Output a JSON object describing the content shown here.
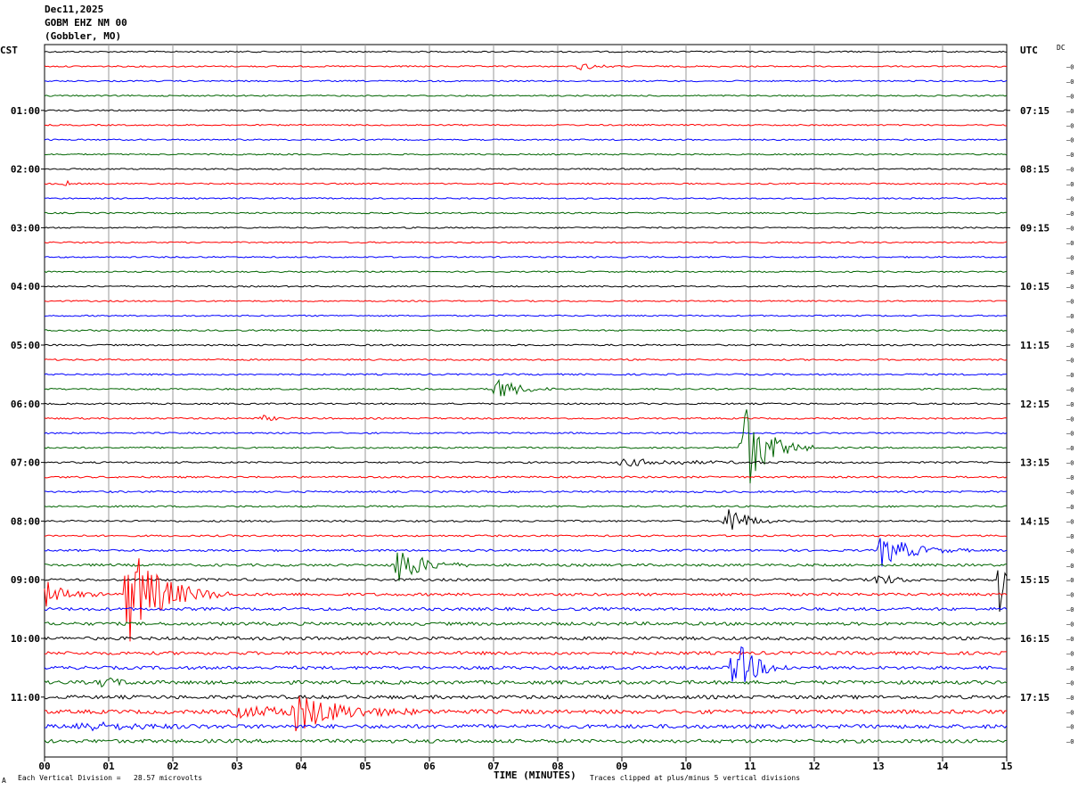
{
  "header": {
    "date": "Dec11,2025",
    "station": "GOBM EHZ NM 00",
    "location": "(Gobbler, MO)"
  },
  "labels": {
    "left_zone": "CST",
    "right_zone": "UTC",
    "dc": "DC",
    "row_marker": "—0",
    "xlabel": "TIME (MINUTES)",
    "scale_note": "Each Vertical Division =   28.57 microvolts",
    "clip_note": "Traces clipped at plus/minus 5 vertical divisions",
    "corner_mark": "A"
  },
  "chart_data": {
    "type": "line",
    "title": "",
    "xlabel": "TIME (MINUTES)",
    "ylabel": "",
    "xlim": [
      0,
      15
    ],
    "x_ticks": [
      "00",
      "01",
      "02",
      "03",
      "04",
      "05",
      "06",
      "07",
      "08",
      "09",
      "10",
      "11",
      "12",
      "13",
      "14",
      "15"
    ],
    "rows": 48,
    "minutes_per_row": 15,
    "row_colors": [
      "#000000",
      "#ff0000",
      "#0000ff",
      "#006400"
    ],
    "left_ticks": [
      {
        "row": 4,
        "label": "01:00"
      },
      {
        "row": 8,
        "label": "02:00"
      },
      {
        "row": 12,
        "label": "03:00"
      },
      {
        "row": 16,
        "label": "04:00"
      },
      {
        "row": 20,
        "label": "05:00"
      },
      {
        "row": 24,
        "label": "06:00"
      },
      {
        "row": 28,
        "label": "07:00"
      },
      {
        "row": 32,
        "label": "08:00"
      },
      {
        "row": 36,
        "label": "09:00"
      },
      {
        "row": 40,
        "label": "10:00"
      },
      {
        "row": 44,
        "label": "11:00"
      }
    ],
    "right_ticks": [
      {
        "row": 4,
        "label": "07:15"
      },
      {
        "row": 8,
        "label": "08:15"
      },
      {
        "row": 12,
        "label": "09:15"
      },
      {
        "row": 16,
        "label": "10:15"
      },
      {
        "row": 20,
        "label": "11:15"
      },
      {
        "row": 24,
        "label": "12:15"
      },
      {
        "row": 28,
        "label": "13:15"
      },
      {
        "row": 32,
        "label": "14:15"
      },
      {
        "row": 36,
        "label": "15:15"
      },
      {
        "row": 40,
        "label": "16:15"
      },
      {
        "row": 44,
        "label": "17:15"
      }
    ],
    "noise_level": [
      0.8,
      0.8,
      0.8,
      0.8,
      0.8,
      0.8,
      0.8,
      0.8,
      0.8,
      0.8,
      0.8,
      0.8,
      0.8,
      0.8,
      0.8,
      0.8,
      0.8,
      0.8,
      0.8,
      0.9,
      0.9,
      0.9,
      0.9,
      0.9,
      0.9,
      0.9,
      0.9,
      0.9,
      1.0,
      1.0,
      1.0,
      1.0,
      1.0,
      1.0,
      1.2,
      1.4,
      1.4,
      1.6,
      1.7,
      1.8,
      1.8,
      1.8,
      1.8,
      2.0,
      2.0,
      2.2,
      2.2,
      2.0
    ],
    "events": [
      {
        "row": 1,
        "time": 8.35,
        "amplitude": 4,
        "duration": 0.5
      },
      {
        "row": 9,
        "time": 0.35,
        "amplitude": 3,
        "duration": 0.1
      },
      {
        "row": 23,
        "time": 7.05,
        "amplitude": 15,
        "duration": 0.6
      },
      {
        "row": 25,
        "time": 3.4,
        "amplitude": 3,
        "duration": 0.4
      },
      {
        "row": 27,
        "time": 10.9,
        "amplitude": 55,
        "duration": 0.7
      },
      {
        "row": 28,
        "time": 9.0,
        "amplitude": 4,
        "duration": 2.0
      },
      {
        "row": 32,
        "time": 10.65,
        "amplitude": 22,
        "duration": 0.5
      },
      {
        "row": 34,
        "time": 13.05,
        "amplitude": 18,
        "duration": 0.9
      },
      {
        "row": 35,
        "time": 5.5,
        "amplitude": 24,
        "duration": 0.7
      },
      {
        "row": 36,
        "time": 12.95,
        "amplitude": 7,
        "duration": 0.6
      },
      {
        "row": 36,
        "time": 14.9,
        "amplitude": 40,
        "duration": 0.1
      },
      {
        "row": 37,
        "time": 0.0,
        "amplitude": 16,
        "duration": 0.6
      },
      {
        "row": 37,
        "time": 1.3,
        "amplitude": 60,
        "duration": 1.0
      },
      {
        "row": 42,
        "time": 10.75,
        "amplitude": 34,
        "duration": 0.6
      },
      {
        "row": 43,
        "time": 0.9,
        "amplitude": 6,
        "duration": 0.5
      },
      {
        "row": 45,
        "time": 3.9,
        "amplitude": 20,
        "duration": 1.2
      },
      {
        "row": 45,
        "time": 3.0,
        "amplitude": 5,
        "duration": 3.0
      },
      {
        "row": 46,
        "time": 0.5,
        "amplitude": 5,
        "duration": 1.5
      }
    ]
  }
}
